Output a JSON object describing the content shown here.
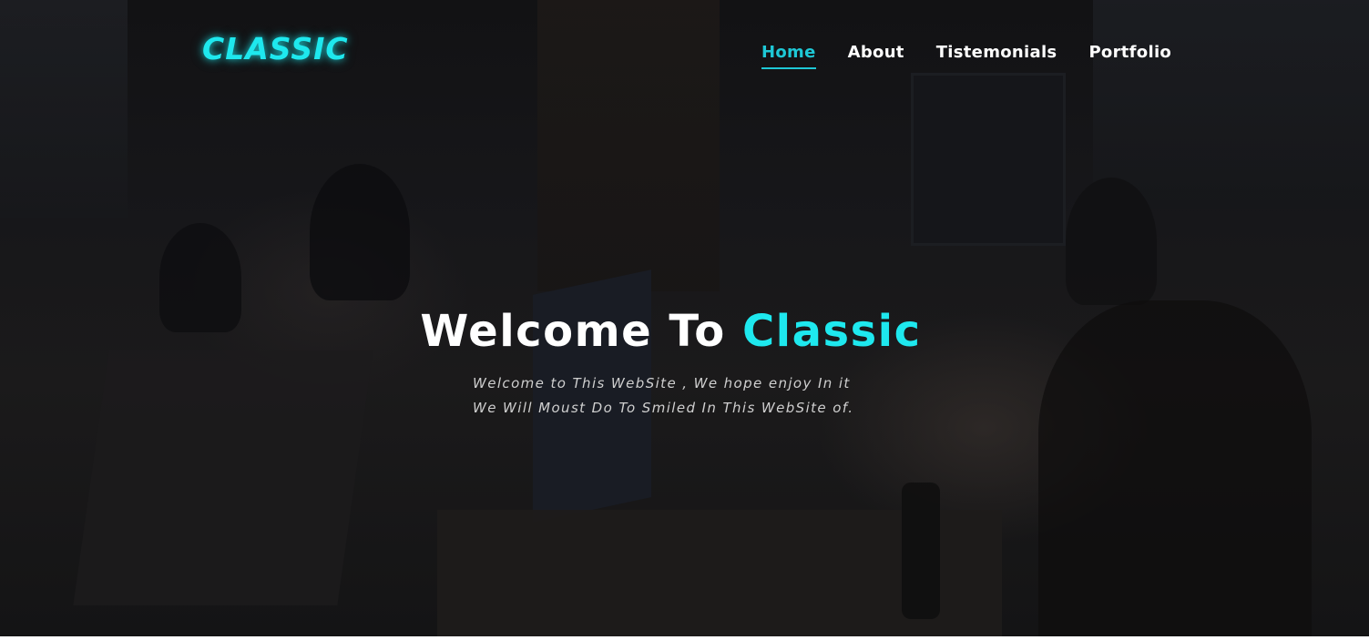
{
  "brand": {
    "logo_text": "CLASSIC",
    "accent_color": "#1ee8ee"
  },
  "nav": {
    "items": [
      {
        "label": "Home",
        "active": true
      },
      {
        "label": "About",
        "active": false
      },
      {
        "label": "Tistemonials",
        "active": false
      },
      {
        "label": "Portfolio",
        "active": false
      }
    ]
  },
  "hero": {
    "headline_prefix": "Welcome To",
    "headline_accent": "Classic",
    "subtext_line1": "Welcome to This WebSite , We hope enjoy In it",
    "subtext_line2": "We Will Moust Do To Smiled In This WebSite of."
  }
}
